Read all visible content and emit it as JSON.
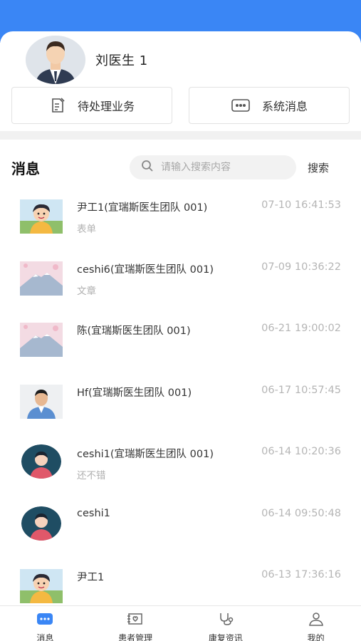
{
  "profile": {
    "name": "刘医生 1"
  },
  "quick_actions": {
    "pending": "待处理业务",
    "system": "系统消息"
  },
  "messages_section": {
    "title": "消息",
    "search_placeholder": "请输入搜索内容",
    "search_button": "搜索"
  },
  "messages": [
    {
      "name": "尹工1(宜瑞斯医生团队 001)",
      "time": "07-10 16:41:53",
      "preview": "表单",
      "thumb": "cartoon-boy"
    },
    {
      "name": "ceshi6(宜瑞斯医生团队 001)",
      "time": "07-09 10:36:22",
      "preview": "文章",
      "thumb": "mountain"
    },
    {
      "name": "陈(宜瑞斯医生团队 001)",
      "time": "06-21 19:00:02",
      "preview": "",
      "thumb": "mountain"
    },
    {
      "name": "Hf(宜瑞斯医生团队 001)",
      "time": "06-17 10:57:45",
      "preview": "",
      "thumb": "man-photo"
    },
    {
      "name": "ceshi1(宜瑞斯医生团队 001)",
      "time": "06-14 10:20:36",
      "preview": "还不错",
      "thumb": "default-avatar"
    },
    {
      "name": "ceshi1",
      "time": "06-14 09:50:48",
      "preview": "",
      "thumb": "default-avatar"
    },
    {
      "name": "尹工1",
      "time": "06-13 17:36:16",
      "preview": "",
      "thumb": "cartoon-boy"
    }
  ],
  "tabbar": {
    "tabs": [
      {
        "label": "消息",
        "icon": "chat-icon",
        "active": true
      },
      {
        "label": "患者管理",
        "icon": "patient-card-icon",
        "active": false
      },
      {
        "label": "康复资讯",
        "icon": "stethoscope-icon",
        "active": false
      },
      {
        "label": "我的",
        "icon": "person-icon",
        "active": false
      }
    ]
  },
  "colors": {
    "accent": "#3a86f5",
    "muted": "#b5b5b5",
    "tab_active": "#3a86f5"
  }
}
